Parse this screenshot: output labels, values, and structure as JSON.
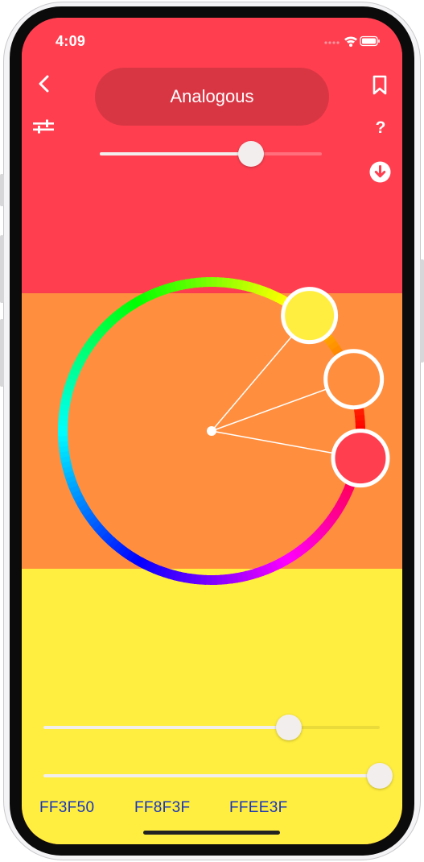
{
  "status_bar": {
    "time": "4:09"
  },
  "header": {
    "back_icon": "chevron-left-icon",
    "mode_label": "Analogous",
    "bookmark_icon": "bookmark-icon",
    "adjust_icon": "sliders-icon",
    "help_label": "?",
    "download_icon": "download-icon"
  },
  "sliders": {
    "spread": 0.68,
    "saturation": 0.73,
    "brightness": 1.0
  },
  "palette": {
    "colors": [
      {
        "hex": "FF3F50",
        "color": "#ff3f50"
      },
      {
        "hex": "FF8F3F",
        "color": "#ff8f3f"
      },
      {
        "hex": "FFEE3F",
        "color": "#ffee3f"
      }
    ]
  }
}
